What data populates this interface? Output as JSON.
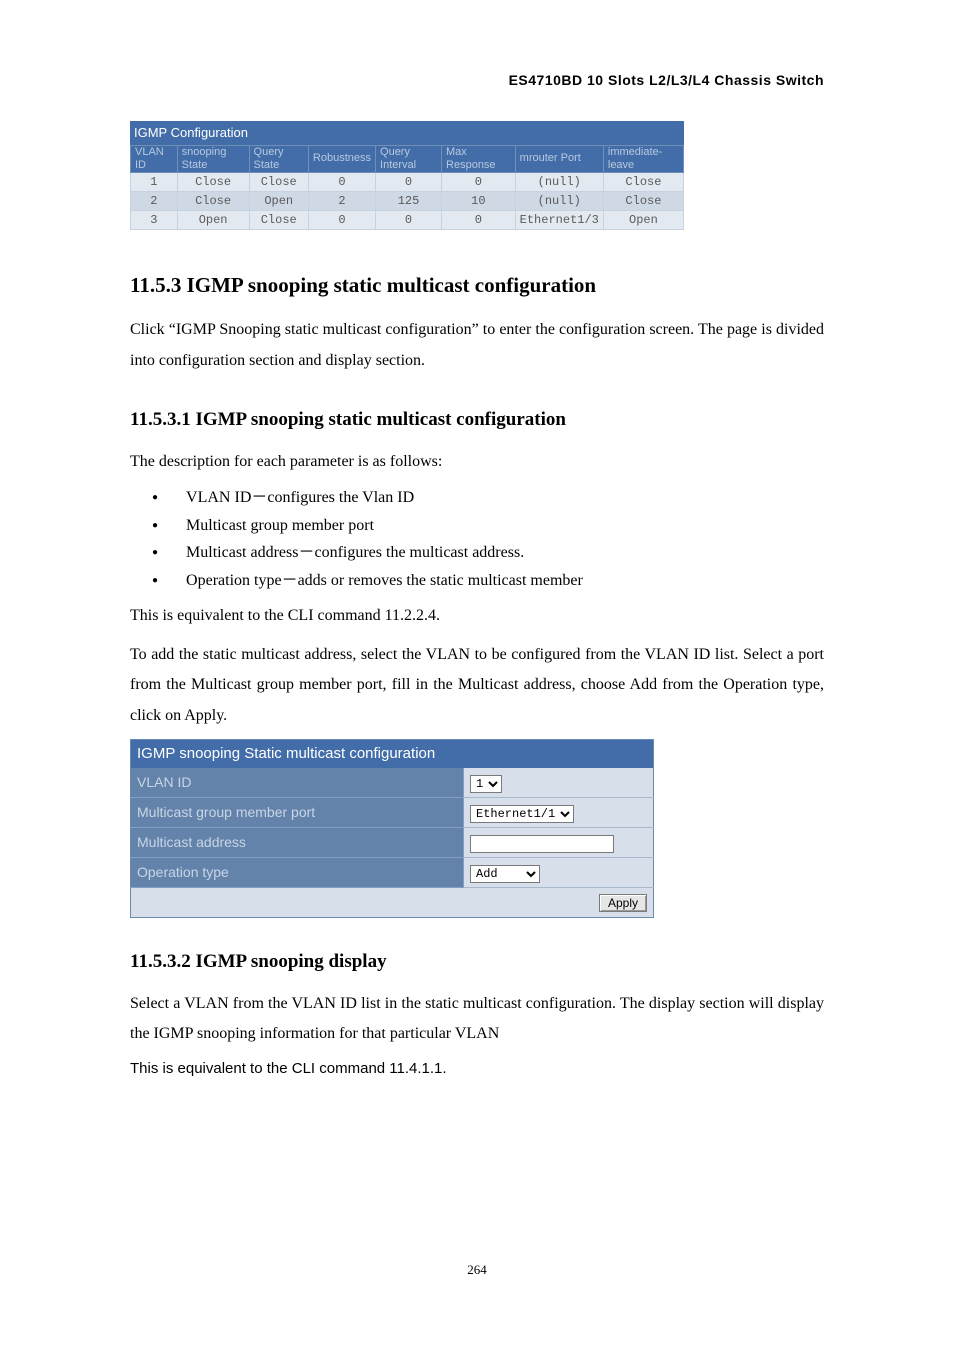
{
  "header": "ES4710BD 10 Slots L2/L3/L4 Chassis Switch",
  "igmp_table": {
    "caption": "IGMP Configuration",
    "headers": [
      "VLAN ID",
      "snooping State",
      "Query State",
      "Robustness",
      "Query Interval",
      "Max Response",
      "mrouter Port",
      "immediate-leave"
    ],
    "rows": [
      [
        "1",
        "Close",
        "Close",
        "0",
        "0",
        "0",
        "(null)",
        "Close"
      ],
      [
        "2",
        "Close",
        "Open",
        "2",
        "125",
        "10",
        "(null)",
        "Close"
      ],
      [
        "3",
        "Open",
        "Close",
        "0",
        "0",
        "0",
        "Ethernet1/3",
        "Open"
      ]
    ]
  },
  "sec1153": {
    "heading": "11.5.3    IGMP snooping static multicast configuration",
    "para": "Click “IGMP Snooping static multicast configuration” to enter the configuration screen. The page is divided into configuration section and display section."
  },
  "sec11531": {
    "heading": "11.5.3.1    IGMP snooping static multicast configuration",
    "intro": "The description for each parameter is as follows:",
    "bullets": [
      "VLAN ID－configures the Vlan ID",
      "Multicast group member port",
      "Multicast address－configures the multicast address.",
      "Operation type－adds or removes the static multicast member"
    ],
    "equiv": "This is equivalent to the CLI command 11.2.2.4.",
    "howto": "To add the static multicast address, select the VLAN to be configured from the VLAN ID list. Select a port from the Multicast group member port, fill in the Multicast address, choose Add from the Operation type, click on Apply."
  },
  "static_conf": {
    "caption": "IGMP snooping Static multicast configuration",
    "rows": {
      "vlan_label": "VLAN ID",
      "vlan_value": "1",
      "port_label": "Multicast group member port",
      "port_value": "Ethernet1/1",
      "addr_label": "Multicast address",
      "addr_value": "",
      "op_label": "Operation type",
      "op_value": "Add"
    },
    "apply": "Apply"
  },
  "sec11532": {
    "heading": "11.5.3.2    IGMP snooping display",
    "para": "Select a VLAN from the VLAN ID list in the static multicast configuration. The display section will display the IGMP snooping information for that particular VLAN",
    "equiv": "This is equivalent to the CLI command 11.4.1.1."
  },
  "page_number": "264"
}
